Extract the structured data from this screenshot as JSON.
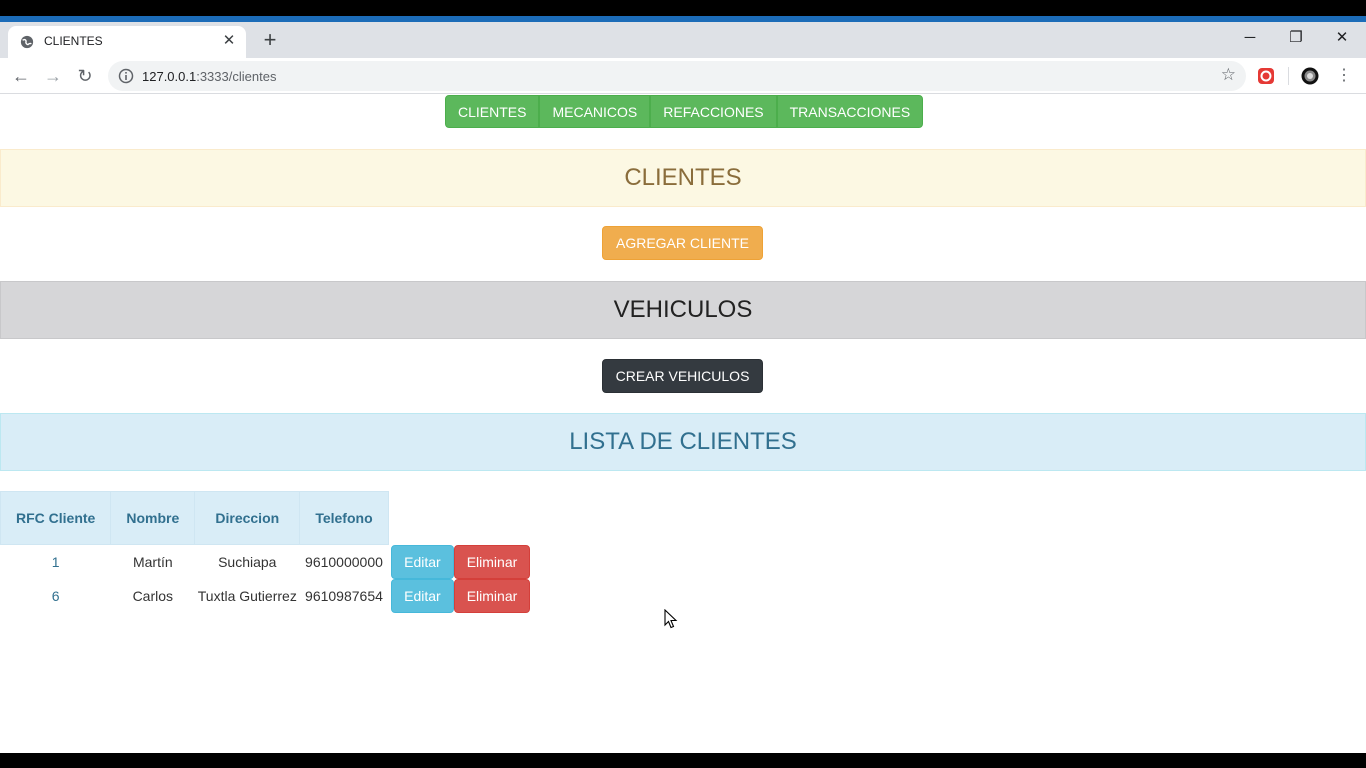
{
  "browser": {
    "tab_title": "CLIENTES",
    "url_host": "127.0.0.1",
    "url_path": ":3333/clientes"
  },
  "nav": {
    "buttons": [
      "CLIENTES",
      "MECANICOS",
      "REFACCIONES",
      "TRANSACCIONES"
    ]
  },
  "sections": {
    "clientes_title": "CLIENTES",
    "add_client_label": "AGREGAR CLIENTE",
    "vehiculos_title": "VEHICULOS",
    "create_vehicles_label": "CREAR VEHICULOS",
    "list_title": "LISTA DE CLIENTES"
  },
  "table": {
    "headers": [
      "RFC Cliente",
      "Nombre",
      "Direccion",
      "Telefono"
    ],
    "rows": [
      {
        "rfc": "1",
        "nombre": "Martín",
        "direccion": "Suchiapa",
        "telefono": "9610000000"
      },
      {
        "rfc": "6",
        "nombre": "Carlos",
        "direccion": "Tuxtla Gutierrez",
        "telefono": "9610987654"
      }
    ],
    "edit_label": "Editar",
    "delete_label": "Eliminar"
  },
  "colors": {
    "accent_bar": "#1c6cb8",
    "nav_green": "#5cb85c",
    "add_orange": "#f0ad4e",
    "create_dark": "#343a40",
    "edit_blue": "#5bc0de",
    "delete_red": "#d9534f"
  }
}
